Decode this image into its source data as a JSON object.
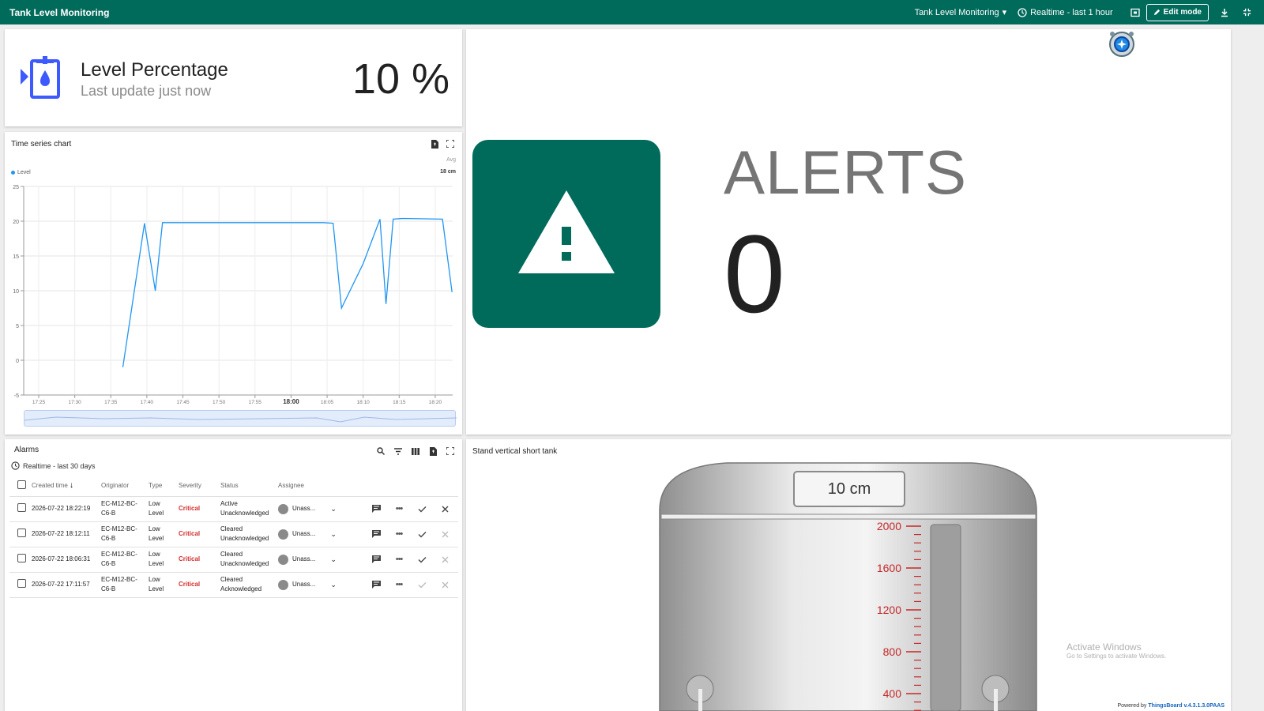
{
  "topbar": {
    "title": "Tank Level Monitoring",
    "dashboard_select": "Tank Level Monitoring",
    "timewindow": "Realtime - last 1 hour",
    "edit_mode": "Edit mode"
  },
  "level_card": {
    "title": "Level Percentage",
    "subtitle": "Last update just now",
    "value": "10 %"
  },
  "timeseries": {
    "title": "Time series chart",
    "legend_label": "Level",
    "avg_label": "Avg",
    "avg_value": "18 cm"
  },
  "chart_data": {
    "type": "line",
    "xlabel": "",
    "ylabel": "",
    "ylim": [
      -5,
      25
    ],
    "yticks": [
      "25",
      "20",
      "15",
      "10",
      "5",
      "0",
      "-5"
    ],
    "xticks": [
      "17:25",
      "17:30",
      "17:35",
      "17:40",
      "17:45",
      "17:50",
      "17:55",
      "18:00",
      "18:05",
      "18:10",
      "18:15",
      "18:20"
    ],
    "grid": true,
    "legend_position": "top-left",
    "series": [
      {
        "name": "Level",
        "color": "#2196f3",
        "x": [
          "17:36:40",
          "17:39:40",
          "17:41:10",
          "17:42:10",
          "18:04:30",
          "18:05:50",
          "18:07:00",
          "18:10:00",
          "18:12:20",
          "18:13:10",
          "18:14:10",
          "18:15:30",
          "18:21:00",
          "18:22:20"
        ],
        "values": [
          -1,
          19.7,
          10,
          19.8,
          19.8,
          19.7,
          7.5,
          13.9,
          20.3,
          8.1,
          20.3,
          20.4,
          20.3,
          9.8
        ]
      }
    ]
  },
  "alarms": {
    "title": "Alarms",
    "timewindow": "Realtime - last 30 days",
    "columns": [
      "Created time",
      "Originator",
      "Type",
      "Severity",
      "Status",
      "Assignee"
    ],
    "rows": [
      {
        "time": "2026-07-22 18:22:19",
        "originator": "EC-M12-BC-C6-B",
        "type": "Low Level",
        "severity": "Critical",
        "status": "Active Unacknowledged",
        "assignee": "Unass..."
      },
      {
        "time": "2026-07-22 18:12:11",
        "originator": "EC-M12-BC-C6-B",
        "type": "Low Level",
        "severity": "Critical",
        "status": "Cleared Unacknowledged",
        "assignee": "Unass..."
      },
      {
        "time": "2026-07-22 18:06:31",
        "originator": "EC-M12-BC-C6-B",
        "type": "Low Level",
        "severity": "Critical",
        "status": "Cleared Unacknowledged",
        "assignee": "Unass..."
      },
      {
        "time": "2026-07-22 17:11:57",
        "originator": "EC-M12-BC-C6-B",
        "type": "Low Level",
        "severity": "Critical",
        "status": "Cleared Acknowledged",
        "assignee": "Unass..."
      }
    ]
  },
  "alerts": {
    "label": "ALERTS",
    "value": "0"
  },
  "tank": {
    "title": "Stand vertical short tank",
    "display_value": "10 cm",
    "scale": [
      "2000",
      "1600",
      "1200",
      "800",
      "400"
    ]
  },
  "watermark": {
    "line1": "Activate Windows",
    "line2": "Go to Settings to activate Windows."
  },
  "footer": {
    "powered_prefix": "Powered by",
    "powered_link": "ThingsBoard v.4.3.1.3.0PAAS"
  },
  "colors": {
    "primary": "#006a5b",
    "series": "#2196f3",
    "critical": "#d32f2f"
  }
}
